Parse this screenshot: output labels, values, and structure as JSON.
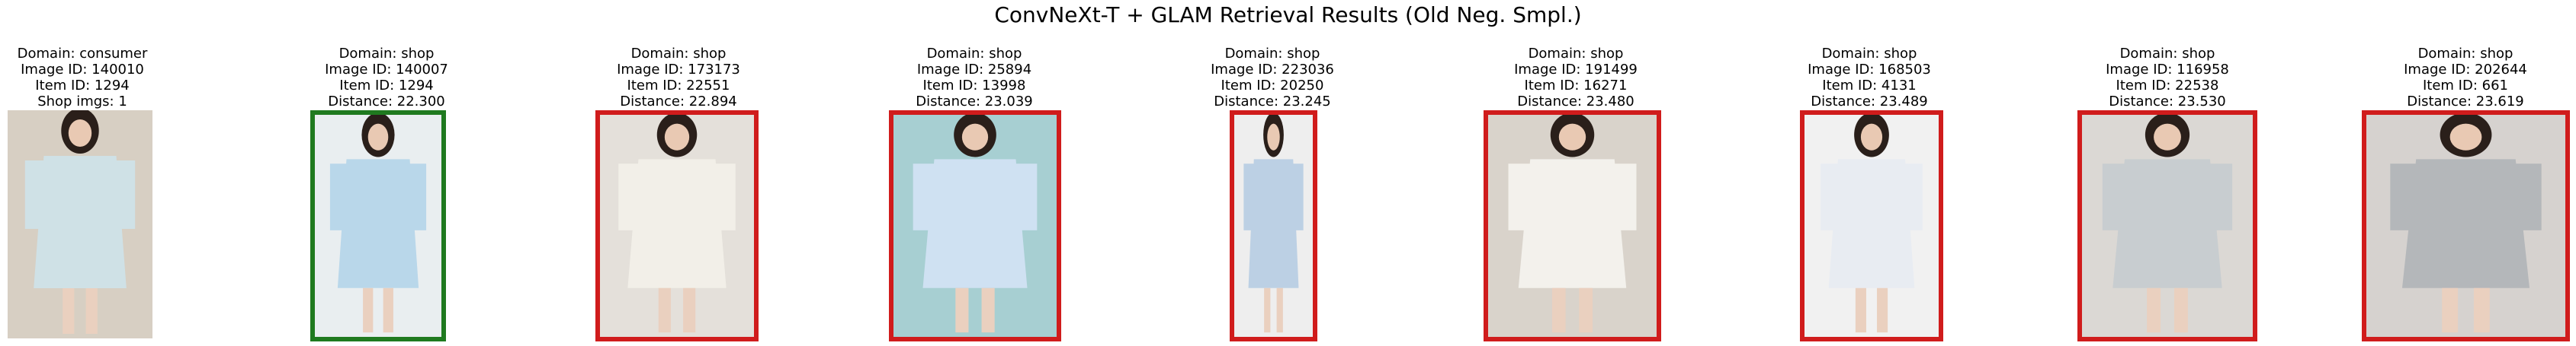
{
  "title": "ConvNeXt-T + GLAM Retrieval Results (Old Neg. Smpl.)",
  "query": {
    "domain": "Domain: consumer",
    "image_id": "Image ID: 140010",
    "item_id": "Item ID: 1294",
    "shop_imgs": "Shop imgs: 1"
  },
  "results": [
    {
      "domain": "Domain: shop",
      "image_id": "Image ID: 140007",
      "item_id": "Item ID: 1294",
      "distance": "Distance: 22.300",
      "match": true,
      "bg": "#e9eef0",
      "dress": "#b9d7ea"
    },
    {
      "domain": "Domain: shop",
      "image_id": "Image ID: 173173",
      "item_id": "Item ID: 22551",
      "distance": "Distance: 22.894",
      "match": false,
      "bg": "#e4e0da",
      "dress": "#f2efe8"
    },
    {
      "domain": "Domain: shop",
      "image_id": "Image ID: 25894",
      "item_id": "Item ID: 13998",
      "distance": "Distance: 23.039",
      "match": false,
      "bg": "#a7cfd2",
      "dress": "#cfe1f2"
    },
    {
      "domain": "Domain: shop",
      "image_id": "Image ID: 223036",
      "item_id": "Item ID: 20250",
      "distance": "Distance: 23.245",
      "match": false,
      "bg": "#eeeeee",
      "dress": "#bcd0e4"
    },
    {
      "domain": "Domain: shop",
      "image_id": "Image ID: 191499",
      "item_id": "Item ID: 16271",
      "distance": "Distance: 23.480",
      "match": false,
      "bg": "#d9d3cb",
      "dress": "#f3f1ec"
    },
    {
      "domain": "Domain: shop",
      "image_id": "Image ID: 168503",
      "item_id": "Item ID: 4131",
      "distance": "Distance: 23.489",
      "match": false,
      "bg": "#f1f1f1",
      "dress": "#e8ecf2"
    },
    {
      "domain": "Domain: shop",
      "image_id": "Image ID: 116958",
      "item_id": "Item ID: 22538",
      "distance": "Distance: 23.530",
      "match": false,
      "bg": "#dbd8d4",
      "dress": "#c8cdd0"
    },
    {
      "domain": "Domain: shop",
      "image_id": "Image ID: 202644",
      "item_id": "Item ID: 661",
      "distance": "Distance: 23.619",
      "match": false,
      "bg": "#d6d2cf",
      "dress": "#b4b7ba"
    }
  ],
  "colors": {
    "match_border": "#1f7a1f",
    "mismatch_border": "#d01c1c"
  }
}
